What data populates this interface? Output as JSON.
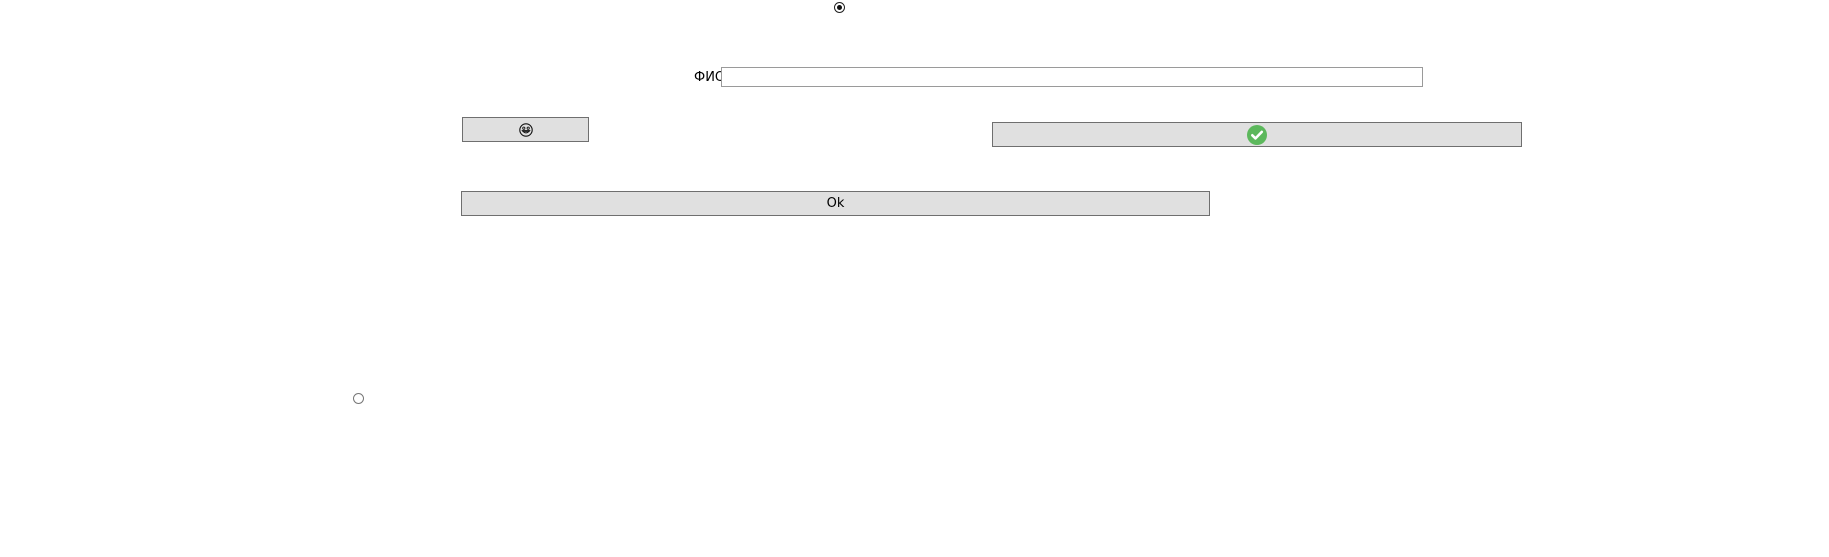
{
  "form": {
    "radio_top": {
      "checked": true
    },
    "radio_bottom": {
      "checked": false
    },
    "fio": {
      "label": "ФИО",
      "value": "",
      "placeholder": ""
    },
    "emoji_button": {
      "icon": "grinning-face-icon"
    },
    "check_button": {
      "icon": "check-circle-icon",
      "icon_color": "#5cb85c"
    },
    "ok_button": {
      "label": "Ok"
    }
  }
}
